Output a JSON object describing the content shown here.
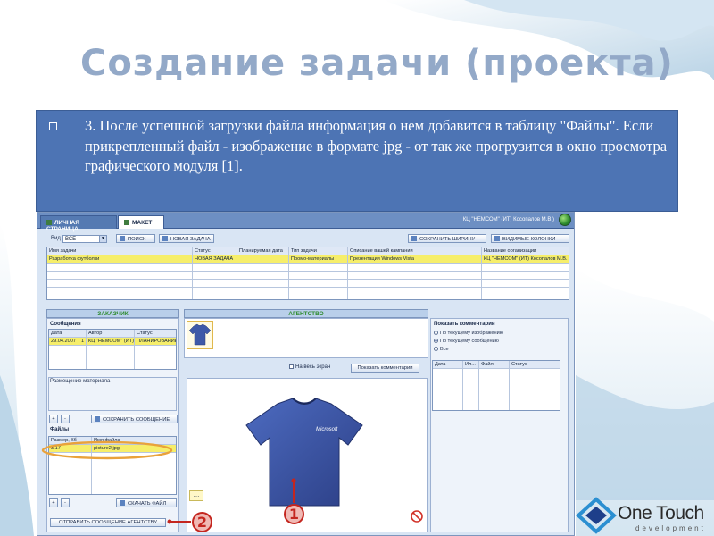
{
  "slide": {
    "title": "Создание задачи (проекта)",
    "text": "3. После успешной загрузки файла информация о нем добавится в таблицу \"Файлы\". Если прикрепленный файл - изображение в формате jpg - от так же прогрузится в окно просмотра графического модуля [1]."
  },
  "app": {
    "tabs": [
      {
        "label": "ЛИЧНАЯ СТРАНИЦА",
        "active": false
      },
      {
        "label": "МАКЕТ",
        "active": true
      }
    ],
    "user": "КЦ \"НЕМСОМ\" (ИТ) Косопалов М.В.)",
    "toolbar": {
      "view_label": "Вид",
      "view_value": "ВСЕ",
      "search_button": "ПОИСК",
      "new_task_button": "НОВАЯ ЗАДАЧА",
      "save_width_button": "СОХРАНИТЬ ШИРИНУ",
      "visible_columns_button": "ВИДИМЫЕ КОЛОНКИ"
    },
    "tasks_table": {
      "columns": [
        "Имя задачи",
        "Статус",
        "Планируемая дата",
        "Тип задачи",
        "Описание вашей кампании",
        "Название организации"
      ],
      "rows": [
        [
          "Разработка футболки",
          "НОВАЯ ЗАДАЧА",
          "",
          "Промо-материалы",
          "Презентация Windows Vista",
          "КЦ \"НЕМСОМ\" (ИТ) Косопалов М.В."
        ]
      ]
    },
    "customer": {
      "header": "ЗАКАЗЧИК",
      "messages_label": "Сообщения",
      "messages_columns": [
        "Дата",
        "",
        "Автор",
        "Статус"
      ],
      "messages_rows": [
        [
          "29.04.2007",
          "1",
          "КЦ \"НЕМСОМ\" (ИТ) Н",
          "ПЛАНИРОВАНИЕ"
        ]
      ],
      "placement_label": "Размещение материала",
      "plus": "+",
      "minus": "-",
      "save_message_button": "СОХРАНИТЬ СООБЩЕНИЕ",
      "files_label": "Файлы",
      "files_columns": [
        "Размер, Кб",
        "Имя файла"
      ],
      "files_rows": [
        [
          "3.17",
          "picture2.jpg"
        ]
      ],
      "download_button": "СКАЧАТЬ ФАЙЛ",
      "send_button": "ОТПРАВИТЬ СООБЩЕНИЕ АГЕНТСТВУ"
    },
    "agency": {
      "header": "АГЕНТСТВО",
      "show_comments_label": "Показать комментарии",
      "radio_options": [
        {
          "label": "По текущему изображению",
          "selected": false
        },
        {
          "label": "По текущему сообщению",
          "selected": true
        },
        {
          "label": "Все",
          "selected": false
        }
      ],
      "fit_screen_label": "На весь экран",
      "show_comments_button": "Показать комментарии",
      "comments_columns": [
        "Дата",
        "Ил...",
        "Файл",
        "Статус"
      ],
      "tshirt_brand": "Microsoft",
      "note_icon": "note-icon"
    }
  },
  "callouts": [
    "1",
    "2"
  ],
  "logo": {
    "name": "One Touch",
    "sub": "development"
  },
  "colors": {
    "title": "#93a9c8",
    "text_box": "#4d74b4",
    "callout": "#c4261f",
    "highlight": "#f6ee6a",
    "panel_header_text": "#2e8b2e"
  }
}
